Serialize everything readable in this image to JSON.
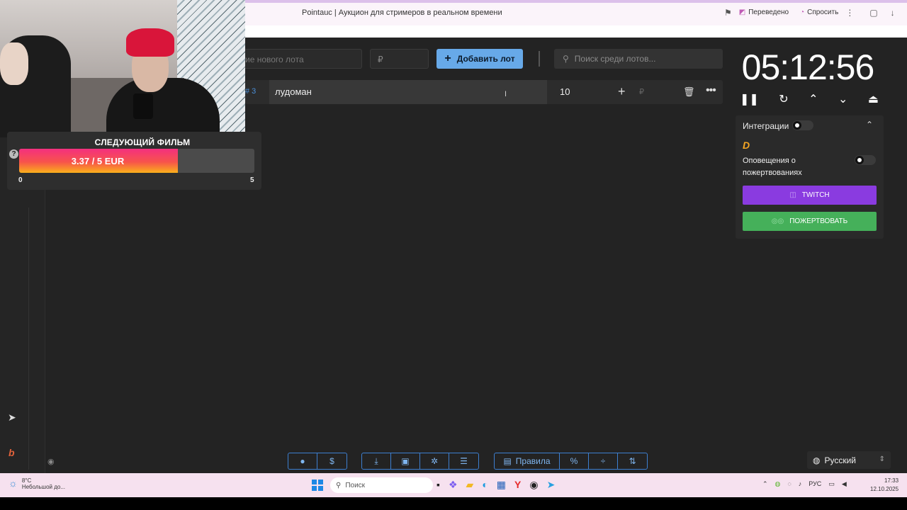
{
  "browser": {
    "tab_title": "Pointauc | Аукцион для стримеров в реальном времени",
    "translated_label": "Переведено",
    "ask_label": "Спросить"
  },
  "widget": {
    "title": "СЛЕДУЮЩИЙ ФИЛЬМ",
    "goal_text": "3.37 / 5 EUR",
    "progress": 0.674,
    "min": "0",
    "max": "5",
    "help": "?"
  },
  "form": {
    "name_placeholder": "ие нового лота",
    "amount_placeholder": "₽",
    "add_button": "Добавить лот",
    "search_placeholder": "Поиск среди лотов..."
  },
  "lots": [
    {
      "index": "# 3",
      "name": "лудоман",
      "amount": "10",
      "currency": "₽"
    }
  ],
  "timer": {
    "value": "05:12:56"
  },
  "integrations": {
    "title": "Интеграции",
    "donation_alerts_label": "Оповещения о пожертвованиях",
    "twitch_button": "TWITCH",
    "donate_button": "ПОЖЕРТВОВАТЬ"
  },
  "toolbar": {
    "rules_label": "Правила",
    "percent_label": "%",
    "dollar_label": "$"
  },
  "language": {
    "selected": "Русский"
  },
  "taskbar": {
    "weather_temp": "8°C",
    "weather_desc": "Небольшой до...",
    "search_placeholder": "Поиск",
    "lang": "РУС",
    "time": "17:33",
    "date": "12.10.2025"
  },
  "colors": {
    "accent_blue": "#67a9e8",
    "twitch_purple": "#8a3be0",
    "donate_green": "#45b05a",
    "app_bg": "#232323"
  }
}
